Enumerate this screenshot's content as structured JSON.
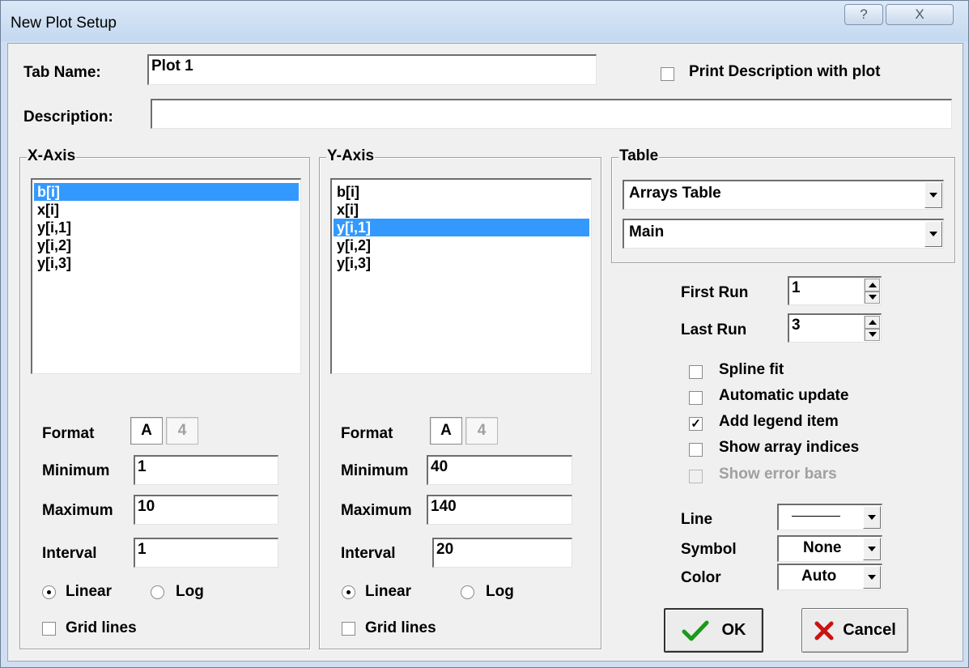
{
  "window": {
    "title": "New Plot Setup",
    "help_glyph": "?",
    "close_glyph": "X"
  },
  "header": {
    "tab_name_label": "Tab Name:",
    "tab_name_value": "Plot 1",
    "print_description_label": "Print Description with plot",
    "print_description_checked": false,
    "description_label": "Description:",
    "description_value": ""
  },
  "x_axis": {
    "group_title": "X-Axis",
    "items": [
      "b[i]",
      "x[i]",
      "y[i,1]",
      "y[i,2]",
      "y[i,3]"
    ],
    "selected_index": 0,
    "format_label": "Format",
    "format_values": [
      "A",
      "4"
    ],
    "minimum_label": "Minimum",
    "minimum_value": "1",
    "maximum_label": "Maximum",
    "maximum_value": "10",
    "interval_label": "Interval",
    "interval_value": "1",
    "scale_options": [
      "Linear",
      "Log"
    ],
    "scale_selected": "Linear",
    "grid_lines_label": "Grid lines",
    "grid_lines_checked": false
  },
  "y_axis": {
    "group_title": "Y-Axis",
    "items": [
      "b[i]",
      "x[i]",
      "y[i,1]",
      "y[i,2]",
      "y[i,3]"
    ],
    "selected_index": 2,
    "format_label": "Format",
    "format_values": [
      "A",
      "4"
    ],
    "minimum_label": "Minimum",
    "minimum_value": "40",
    "maximum_label": "Maximum",
    "maximum_value": "140",
    "interval_label": "Interval",
    "interval_value": "20",
    "scale_options": [
      "Linear",
      "Log"
    ],
    "scale_selected": "Linear",
    "grid_lines_label": "Grid lines",
    "grid_lines_checked": false
  },
  "table": {
    "group_title": "Table",
    "table_select": "Arrays Table",
    "subtable_select": "Main"
  },
  "runs": {
    "first_run_label": "First Run",
    "first_run_value": "1",
    "last_run_label": "Last Run",
    "last_run_value": "3"
  },
  "options": {
    "spline_fit": {
      "label": "Spline fit",
      "checked": false,
      "enabled": true
    },
    "automatic_update": {
      "label": "Automatic update",
      "checked": false,
      "enabled": true
    },
    "add_legend_item": {
      "label": "Add legend item",
      "checked": true,
      "enabled": true
    },
    "show_array_indices": {
      "label": "Show array indices",
      "checked": false,
      "enabled": true
    },
    "show_error_bars": {
      "label": "Show error bars",
      "checked": false,
      "enabled": false
    }
  },
  "style": {
    "line_label": "Line",
    "symbol_label": "Symbol",
    "symbol_value": "None",
    "color_label": "Color",
    "color_value": "Auto"
  },
  "buttons": {
    "ok_label": "OK",
    "cancel_label": "Cancel"
  },
  "colors": {
    "selection": "#3399ff",
    "ok_icon": "#1a9a1a",
    "cancel_icon": "#cc1111"
  },
  "icons": {
    "ok": "checkmark-icon",
    "cancel": "x-icon",
    "check": "✓"
  }
}
